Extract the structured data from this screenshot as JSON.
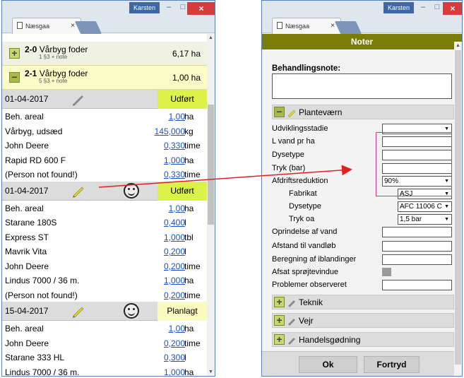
{
  "left": {
    "user": "Karsten",
    "tab_title": "Næsgaa",
    "tab_close": "×",
    "fields": [
      {
        "number": "2-0",
        "name": "Vårbyg foder",
        "sub": "1 §3 + note",
        "area": "6,17 ha",
        "toggle": "+"
      },
      {
        "number": "2-1",
        "name": "Vårbyg foder",
        "sub": "5 §3 + note",
        "area": "1,00 ha",
        "toggle": "−"
      }
    ],
    "groups": [
      {
        "date": "01-04-2017",
        "status": "Udført",
        "lines": [
          {
            "label": "Beh. areal",
            "value": "1,00",
            "unit": "ha"
          },
          {
            "label": "Vårbyg, udsæd",
            "value": "145,000",
            "unit": "kg"
          },
          {
            "label": "John Deere",
            "value": "0,330",
            "unit": "time"
          },
          {
            "label": "Rapid RD 600 F",
            "value": "1,000",
            "unit": "ha"
          },
          {
            "label": "(Person not found!)",
            "value": "0,330",
            "unit": "time"
          }
        ]
      },
      {
        "date": "01-04-2017",
        "status": "Udført",
        "lines": [
          {
            "label": "Beh. areal",
            "value": "1,00",
            "unit": "ha"
          },
          {
            "label": "Starane 180S",
            "value": "0,400",
            "unit": "l"
          },
          {
            "label": "Express ST",
            "value": "1,000",
            "unit": "tbl"
          },
          {
            "label": "Mavrik Vita",
            "value": "0,200",
            "unit": "l"
          },
          {
            "label": "John Deere",
            "value": "0,200",
            "unit": "time"
          },
          {
            "label": "Lindus 7000 / 36 m.",
            "value": "1,000",
            "unit": "ha"
          },
          {
            "label": "(Person not found!)",
            "value": "0,200",
            "unit": "time"
          }
        ]
      },
      {
        "date": "15-04-2017",
        "status": "Planlagt",
        "lines": [
          {
            "label": "Beh. areal",
            "value": "1,00",
            "unit": "ha"
          },
          {
            "label": "John Deere",
            "value": "0,200",
            "unit": "time"
          },
          {
            "label": "Starane 333 HL",
            "value": "0,300",
            "unit": "l"
          },
          {
            "label": "Lindus 7000 / 36 m.",
            "value": "1,000",
            "unit": "ha"
          }
        ]
      }
    ]
  },
  "right": {
    "user": "Karsten",
    "tab_title": "Næsgaa",
    "tab_close": "×",
    "header": "Noter",
    "note_label": "Behandlingsnote:",
    "sections": {
      "plantevaern": "Planteværn",
      "teknik": "Teknik",
      "vejr": "Vejr",
      "handel": "Handelsgødning"
    },
    "form": {
      "udviklingsstadie": "Udviklingsstadie",
      "l_vand": "L vand pr ha",
      "dysetype": "Dysetype",
      "tryk": "Tryk (bar)",
      "afdrift": "Afdriftsreduktion",
      "afdrift_value": "90%",
      "fabrikat": "Fabrikat",
      "fabrikat_value": "ASJ",
      "dysetype2": "Dysetype",
      "dysetype2_value": "AFC 11006 C",
      "tryk_oa": "Tryk oa",
      "tryk_oa_value": "1,5 bar",
      "oprindelse": "Oprindelse af vand",
      "afstand": "Afstand til vandløb",
      "beregning": "Beregning af iblandinger",
      "afsat": "Afsat sprøjtevindue",
      "problemer": "Problemer observeret"
    },
    "ok": "Ok",
    "cancel": "Fortryd"
  },
  "colors": {
    "status_done": "#dcf14a",
    "status_planned": "#fbfbc0",
    "header_olive": "#7a7e08",
    "link_blue": "#1a4fd6",
    "annotation_red": "#e02020",
    "annotation_pink": "#e0308a"
  }
}
